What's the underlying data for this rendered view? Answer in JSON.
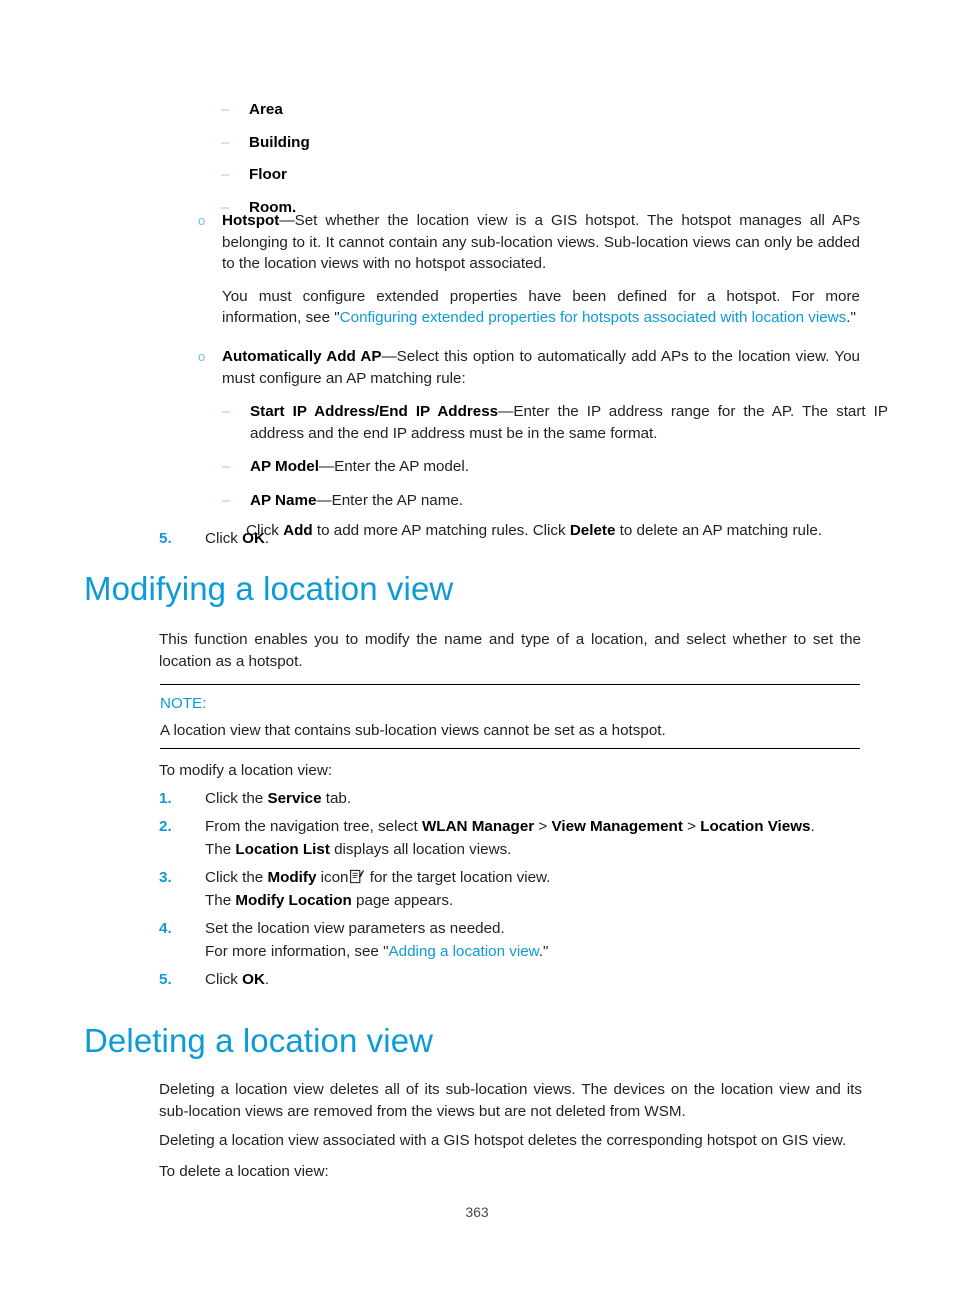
{
  "document": {
    "page_number": "363"
  },
  "colors": {
    "heading_blue": "#0d9ad8",
    "link_blue": "#0d9ad8",
    "bullet_light_blue": "#8ecdf0",
    "body_black": "#231f20"
  },
  "location_type_bullets": [
    {
      "marker": "–",
      "label": "Area"
    },
    {
      "marker": "–",
      "label": "Building"
    },
    {
      "marker": "–",
      "label": "Floor"
    },
    {
      "marker": "–",
      "label": "Room."
    }
  ],
  "hotspot_bullet": {
    "marker": "o",
    "term": "Hotspot",
    "dash": "—",
    "body": "Set whether the location view is a GIS hotspot. The hotspot manages all APs belonging to it. It cannot contain any sub-location views. Sub-location views can only be added to the location views with no hotspot associated.",
    "followup_prefix": "You must configure extended properties have been defined for a hotspot. For more information, see \"",
    "followup_link": "Configuring extended properties for hotspots associated with location views",
    "followup_suffix": ".\""
  },
  "auto_add_ap_bullet": {
    "marker": "o",
    "term": "Automatically Add AP",
    "dash": "—",
    "body": "Select this option to automatically add APs to the location view. You must configure an AP matching rule:",
    "sub_items": [
      {
        "marker": "–",
        "term_a": "Start IP Address",
        "separator": "/",
        "term_b": "End IP Address",
        "dash": "—",
        "body": "Enter the IP address range for the AP. The start IP address and the end IP address must be in the same format."
      },
      {
        "marker": "–",
        "term_a": "AP Model",
        "dash": "—",
        "body": "Enter the AP model."
      },
      {
        "marker": "–",
        "term_a": "AP Name",
        "dash": "—",
        "body": "Enter the AP name."
      }
    ],
    "closing_note": {
      "pre": "Click ",
      "bold_a": "Add",
      "mid": " to add more AP matching rules. Click ",
      "bold_b": "Delete",
      "post": " to delete an AP matching rule."
    }
  },
  "adding_step_5": {
    "num": "5.",
    "pre": "Click ",
    "bold": "OK",
    "post": "."
  },
  "modifying_section": {
    "heading": "Modifying a location view",
    "intro": "This function enables you to modify the name and type of a location, and select whether to set the location as a hotspot.",
    "note": {
      "label": "NOTE:",
      "text": "A location view that contains sub-location views cannot be set as a hotspot."
    },
    "lead_in": "To modify a location view:",
    "steps": [
      {
        "num": "1.",
        "pre": "Click the ",
        "bold": "Service",
        "post": " tab."
      },
      {
        "num": "2.",
        "pre": "From the navigation tree, select ",
        "bold": "WLAN Manager",
        "sep1": " > ",
        "bold2": "View Management",
        "sep2": " > ",
        "bold3": "Location Views",
        "post": ".",
        "sub_pre": "The ",
        "sub_bold": "Location List",
        "sub_post": " displays all location views."
      },
      {
        "num": "3.",
        "pre": "Click the ",
        "bold": "Modify",
        "mid": " icon",
        "icon": "modify-pencil-icon",
        "post": " for the target location view.",
        "sub_pre": "The ",
        "sub_bold": "Modify Location",
        "sub_post": " page appears."
      },
      {
        "num": "4.",
        "text": "Set the location view parameters as needed.",
        "sub_pre": "For more information, see \"",
        "sub_link": "Adding a location view",
        "sub_post": ".\""
      },
      {
        "num": "5.",
        "pre": "Click ",
        "bold": "OK",
        "post": "."
      }
    ]
  },
  "deleting_section": {
    "heading": "Deleting a location view",
    "paragraph_1": "Deleting a location view deletes all of its sub-location views. The devices on the location view and its sub-location views are removed from the views but are not deleted from WSM.",
    "paragraph_2": "Deleting a location view associated with a GIS hotspot deletes the corresponding hotspot on GIS view.",
    "lead_in": "To delete a location view:"
  }
}
